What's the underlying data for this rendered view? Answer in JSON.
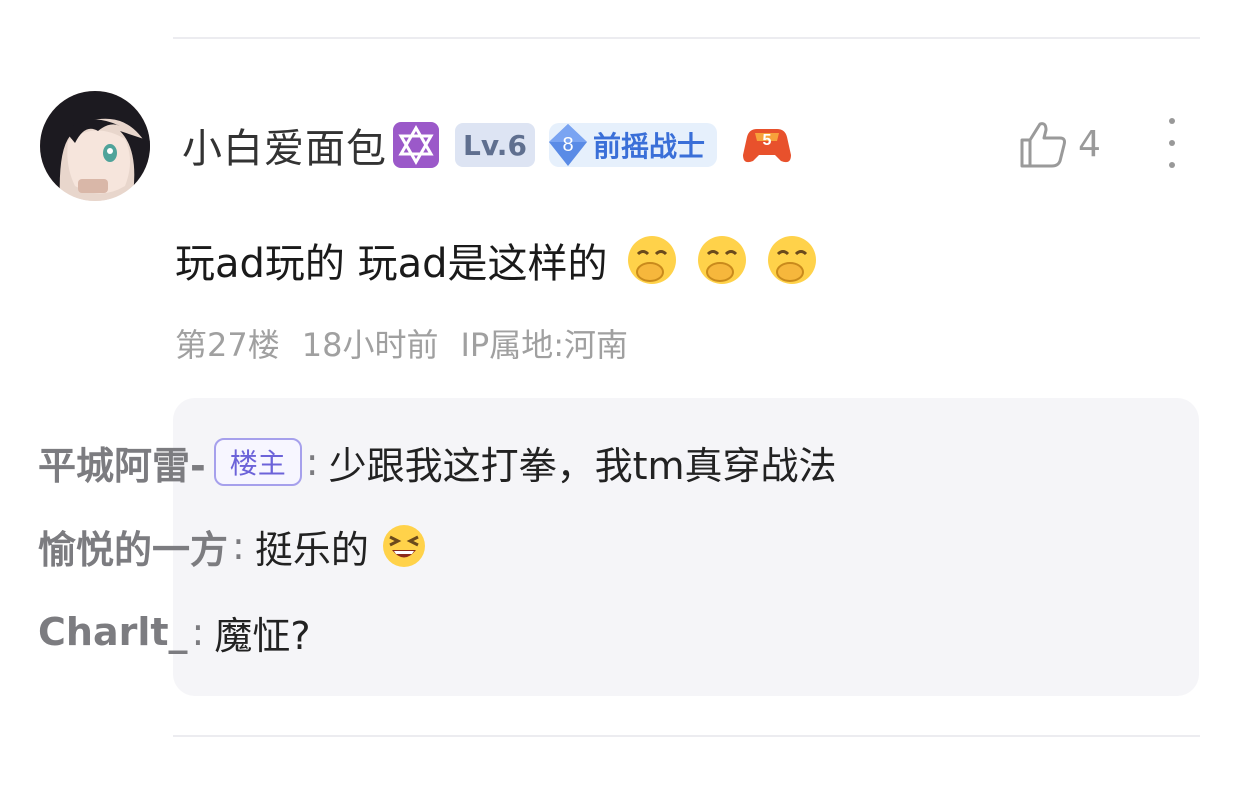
{
  "comment": {
    "username": "小白爱面包",
    "level_badge": "Lv.6",
    "title_badge_number": "8",
    "title_badge_text": "前摇战士",
    "game_badge_number": "5",
    "like_count": "4",
    "content": "玩ad玩的 玩ad是这样的",
    "emoji_icon": "cover-mouth-laugh-emoji",
    "meta": {
      "floor": "第27楼",
      "time": "18小时前",
      "ip": "IP属地:河南"
    }
  },
  "replies": [
    {
      "name": "平城阿雷-",
      "tag": "楼主",
      "separator": ":",
      "text": "少跟我这打拳，我tm真穿战法"
    },
    {
      "name": "愉悦的一方",
      "separator": ":",
      "text": "挺乐的"
    },
    {
      "name": "Charlt_",
      "separator": ":",
      "text": "魔怔?"
    }
  ],
  "colors": {
    "accent_blue": "#3a6fd8",
    "louzhu_purple": "#6c63d9",
    "meta_gray": "#a0a0a0",
    "reply_bg": "#f5f5f8"
  }
}
